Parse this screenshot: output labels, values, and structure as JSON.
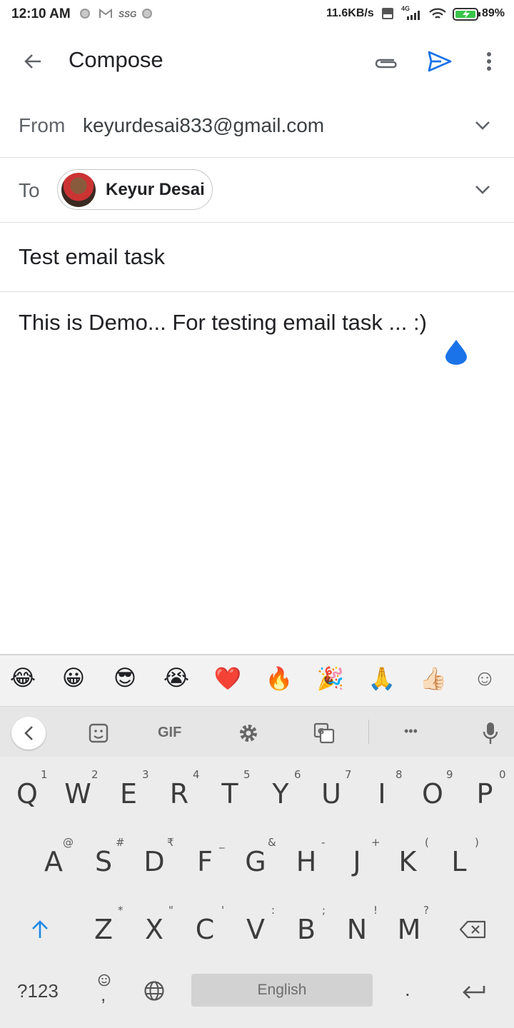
{
  "status_bar": {
    "time": "12:10 AM",
    "speed": "11.6KB/s",
    "network": "4G",
    "battery": "89%"
  },
  "app_bar": {
    "title": "Compose",
    "icons": [
      "back-arrow-icon",
      "attachment-icon",
      "send-icon",
      "more-vert-icon"
    ]
  },
  "from": {
    "label": "From",
    "value": "keyurdesai833@gmail.com"
  },
  "to": {
    "label": "To",
    "recipient": "Keyur Desai"
  },
  "subject": "Test email task",
  "body": "This is Demo... For testing email task ... :)",
  "keyboard": {
    "emojis": [
      "😂",
      "😀",
      "😎",
      "😭",
      "❤️",
      "🔥",
      "🎉",
      "🙏",
      "👍🏻",
      "☺"
    ],
    "toolbar": {
      "gif_label": "GIF",
      "more_label": "•••"
    },
    "row1": [
      "Q",
      "W",
      "E",
      "R",
      "T",
      "Y",
      "U",
      "I",
      "O",
      "P"
    ],
    "row1_hints": [
      "1",
      "2",
      "3",
      "4",
      "5",
      "6",
      "7",
      "8",
      "9",
      "0"
    ],
    "row2": [
      "A",
      "S",
      "D",
      "F",
      "G",
      "H",
      "J",
      "K",
      "L"
    ],
    "row2_hints": [
      "@",
      "#",
      "₹",
      "_",
      "&",
      "-",
      "+",
      "(",
      ")"
    ],
    "row3": [
      "Z",
      "X",
      "C",
      "V",
      "B",
      "N",
      "M"
    ],
    "row3_hints": [
      "*",
      "\"",
      "'",
      ":",
      ";",
      "!",
      "?"
    ],
    "symbols_label": "?123",
    "comma": ",",
    "space_label": "English",
    "period": "."
  },
  "colors": {
    "accent": "#1a73e8",
    "keyboard_bg": "#ececec"
  }
}
